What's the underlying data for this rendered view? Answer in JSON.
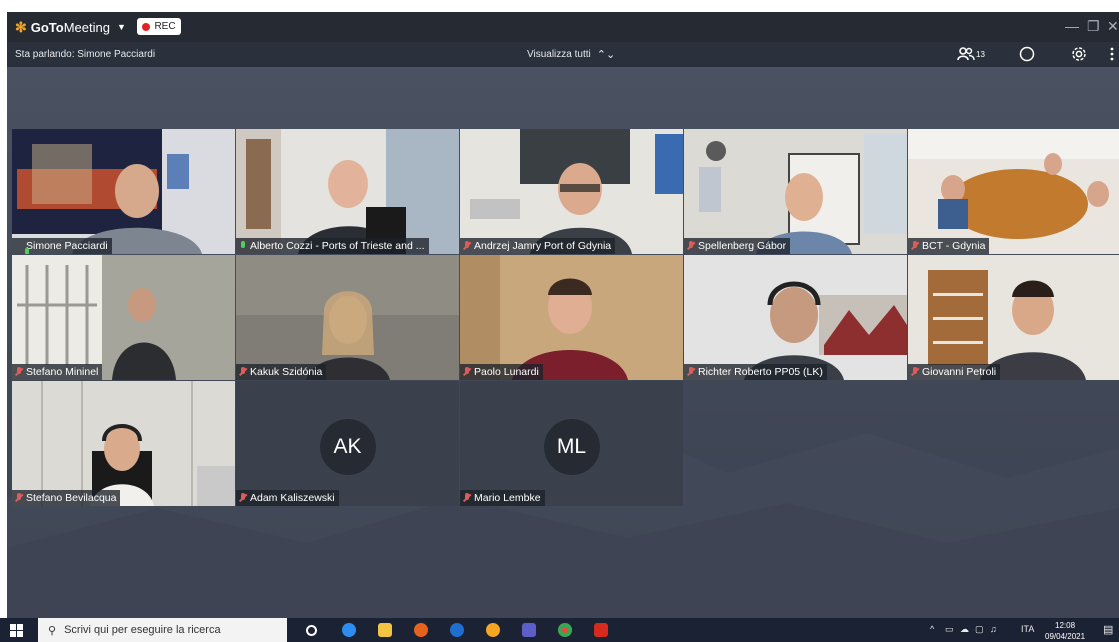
{
  "app": {
    "brand_goto": "GoTo",
    "brand_meeting": "Meeting",
    "rec_label": "REC"
  },
  "toolbar": {
    "speaking_label": "Sta parlando: Simone Pacciardi",
    "view_all_label": "Visualizza tutti",
    "attendee_count": "13"
  },
  "participants": [
    {
      "name": "Simone Pacciardi",
      "mic": "speaking"
    },
    {
      "name": "Alberto Cozzi - Ports of Trieste and ...",
      "mic": "on"
    },
    {
      "name": "Andrzej Jamry Port of Gdynia",
      "mic": "muted"
    },
    {
      "name": "Spellenberg Gábor",
      "mic": "muted"
    },
    {
      "name": "BCT - Gdynia",
      "mic": "muted"
    },
    {
      "name": "Stefano Mininel",
      "mic": "muted"
    },
    {
      "name": "Kakuk Szidónia",
      "mic": "muted"
    },
    {
      "name": "Paolo Lunardi",
      "mic": "muted"
    },
    {
      "name": "Richter Roberto PP05 (LK)",
      "mic": "muted"
    },
    {
      "name": "Giovanni Petroli",
      "mic": "muted"
    },
    {
      "name": "Stefano Bevilacqua",
      "mic": "muted"
    },
    {
      "name": "Adam Kaliszewski",
      "mic": "muted",
      "initials": "AK"
    },
    {
      "name": "Mario Lembke",
      "mic": "muted",
      "initials": "ML"
    }
  ],
  "taskbar": {
    "search_placeholder": "Scrivi qui per eseguire la ricerca",
    "language": "ITA",
    "time": "12:08",
    "date": "09/04/2021"
  },
  "colors": {
    "rec_dot": "#e02424",
    "brand_star": "#f5a623",
    "mic_muted": "#e05a5a",
    "mic_active": "#4fcf5c"
  }
}
